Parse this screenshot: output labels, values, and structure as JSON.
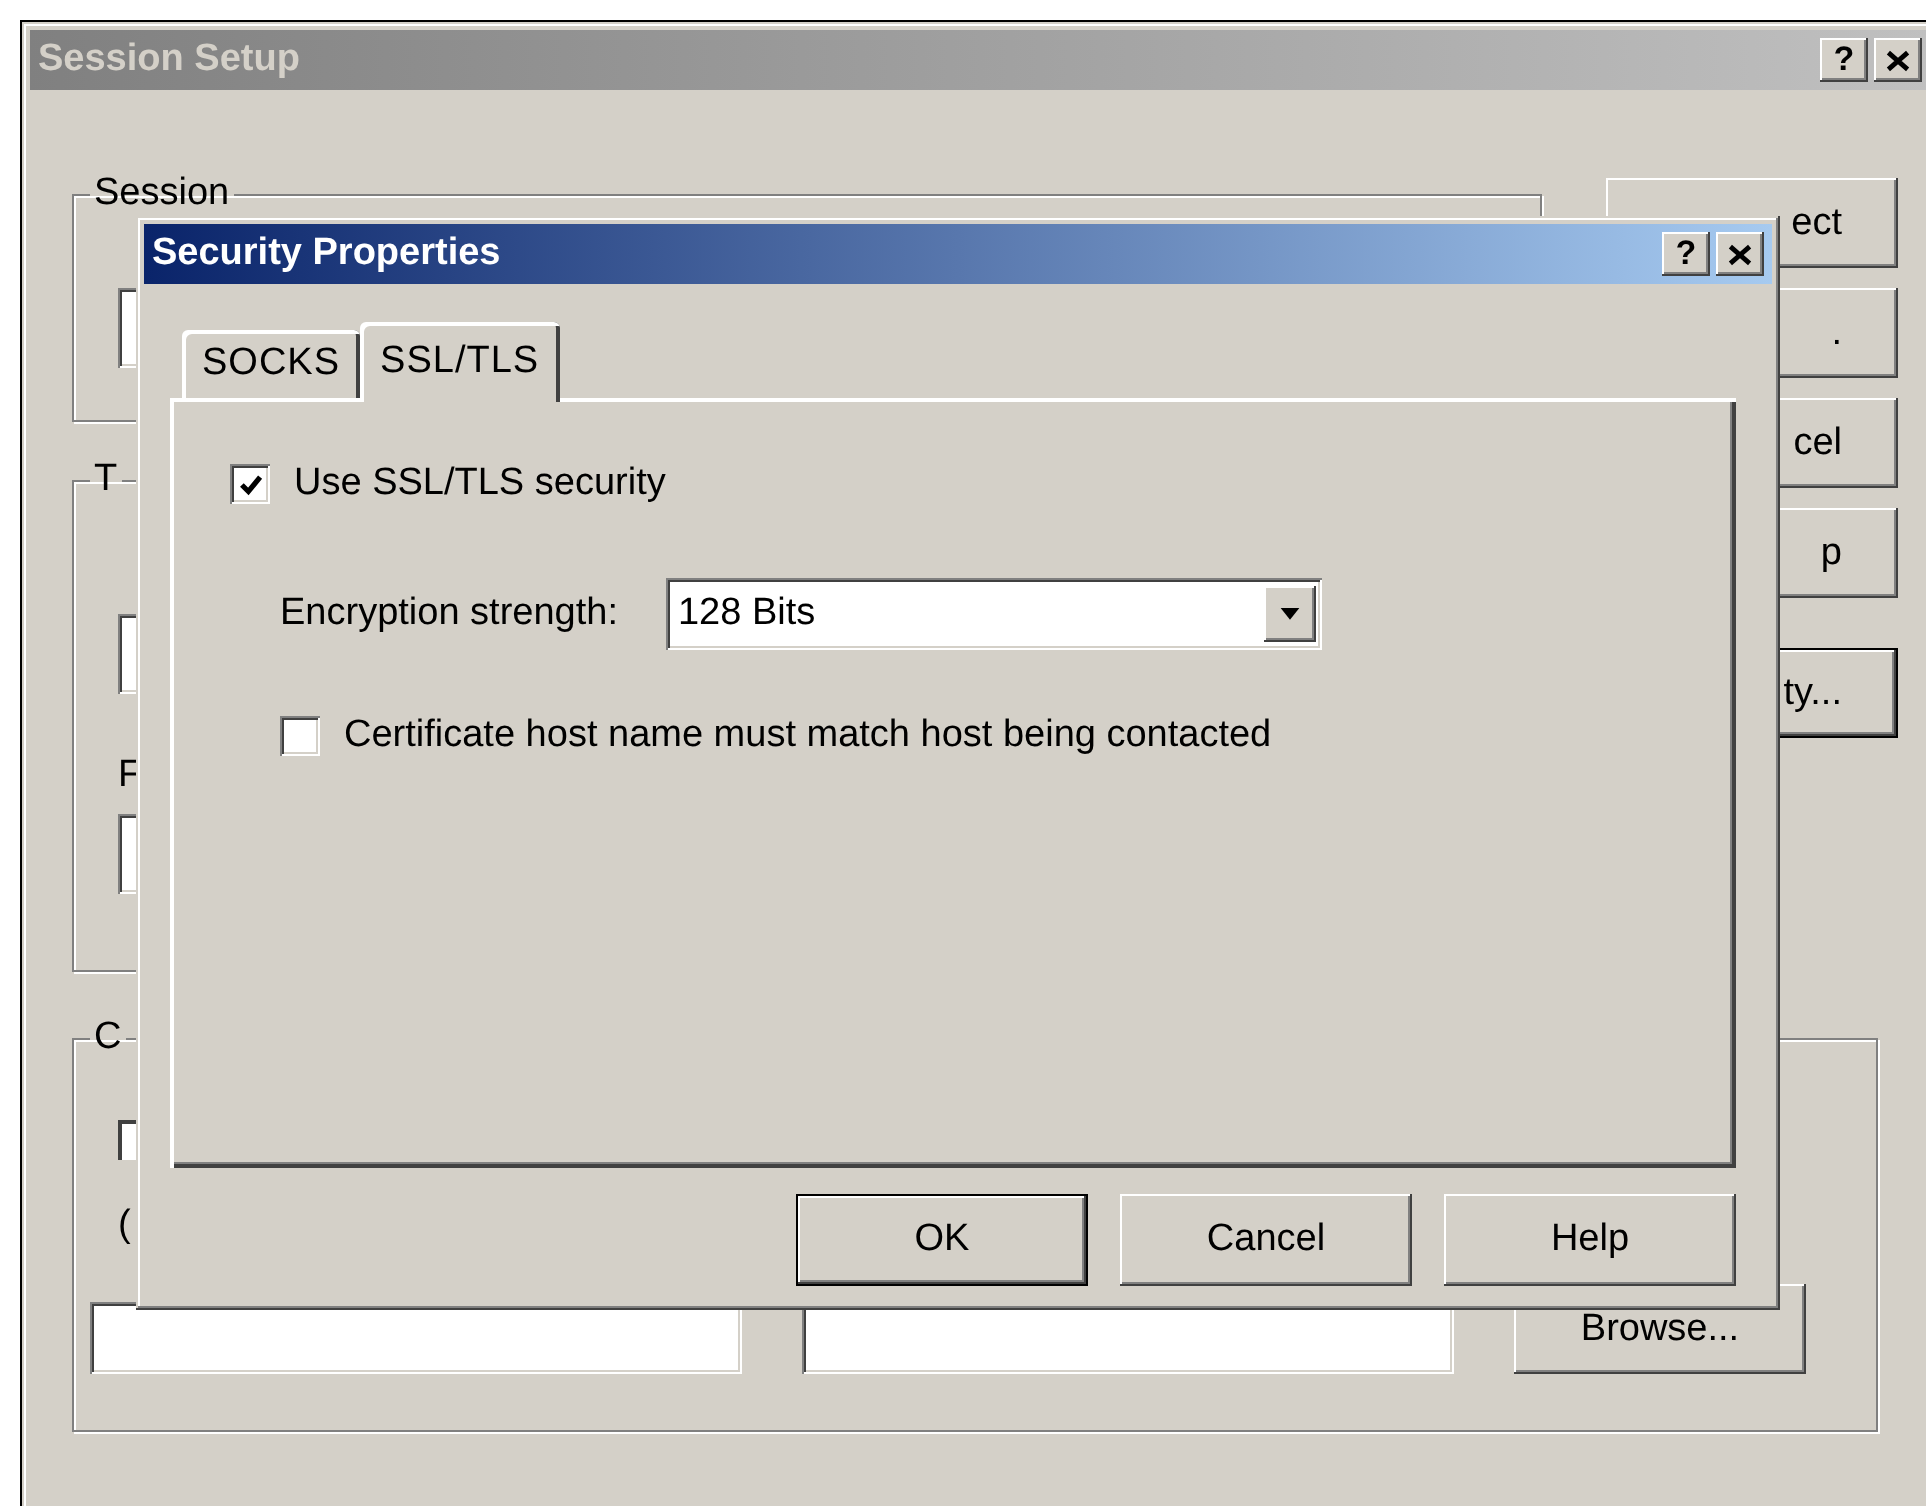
{
  "background_window": {
    "title": "Session Setup",
    "help_button": "?",
    "groups": [
      {
        "label": "Session"
      },
      {
        "label": "T",
        "field_label": "F"
      },
      {
        "label": "C",
        "field_label": "(",
        "checked": false
      }
    ],
    "buttons": [
      {
        "label": "ect",
        "default": false
      },
      {
        "label": ".",
        "default": false
      },
      {
        "label": "cel",
        "default": false
      },
      {
        "label": "p",
        "default": false
      },
      {
        "label": "ty...",
        "default": true
      }
    ],
    "browse_button": "Browse..."
  },
  "dialog": {
    "title": "Security Properties",
    "help_button": "?",
    "tabs": [
      {
        "label": "SOCKS",
        "selected": false
      },
      {
        "label": "SSL/TLS",
        "selected": true
      }
    ],
    "options": [
      {
        "kind": "checkbox",
        "label": "Use SSL/TLS security",
        "checked": true,
        "children": [
          {
            "kind": "select",
            "label": "Encryption strength:",
            "value": "128 Bits"
          },
          {
            "kind": "checkbox",
            "label": "Certificate host name must match host being contacted",
            "checked": false
          }
        ]
      }
    ],
    "buttons": [
      {
        "label": "OK",
        "default": true
      },
      {
        "label": "Cancel",
        "default": false
      },
      {
        "label": "Help",
        "default": false
      }
    ]
  }
}
